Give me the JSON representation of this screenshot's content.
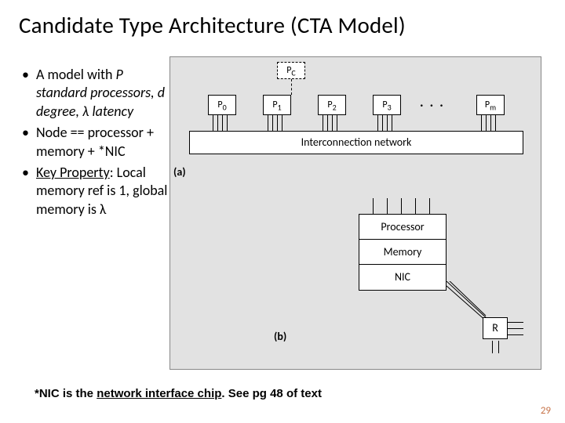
{
  "title": "Candidate Type Architecture (CTA Model)",
  "bullets": {
    "b1_pre": "A model with ",
    "b1_P": "P",
    "b1_mid1": " standard processors, ",
    "b1_d": "d",
    "b1_mid2": " degree, ",
    "b1_lambda": "λ",
    "b1_end": " latency",
    "b2": "Node == processor + memory + *NIC",
    "b3_key": "Key Property",
    "b3_rest": ": Local memory ref is 1, global memory is λ"
  },
  "diagram": {
    "pc": "P",
    "pc_sub": "C",
    "p": "P",
    "p_subs": [
      "0",
      "1",
      "2",
      "3",
      "m"
    ],
    "dots": "· · ·",
    "interconnect": "Interconnection network",
    "label_a": "(a)",
    "detail": {
      "proc": "Processor",
      "mem": "Memory",
      "nic": "NIC"
    },
    "r": "R",
    "label_b": "(b)"
  },
  "footnote": {
    "pre": "*NIC is the ",
    "term": "network interface chip",
    "post": ". See pg 48 of text"
  },
  "page": "29"
}
